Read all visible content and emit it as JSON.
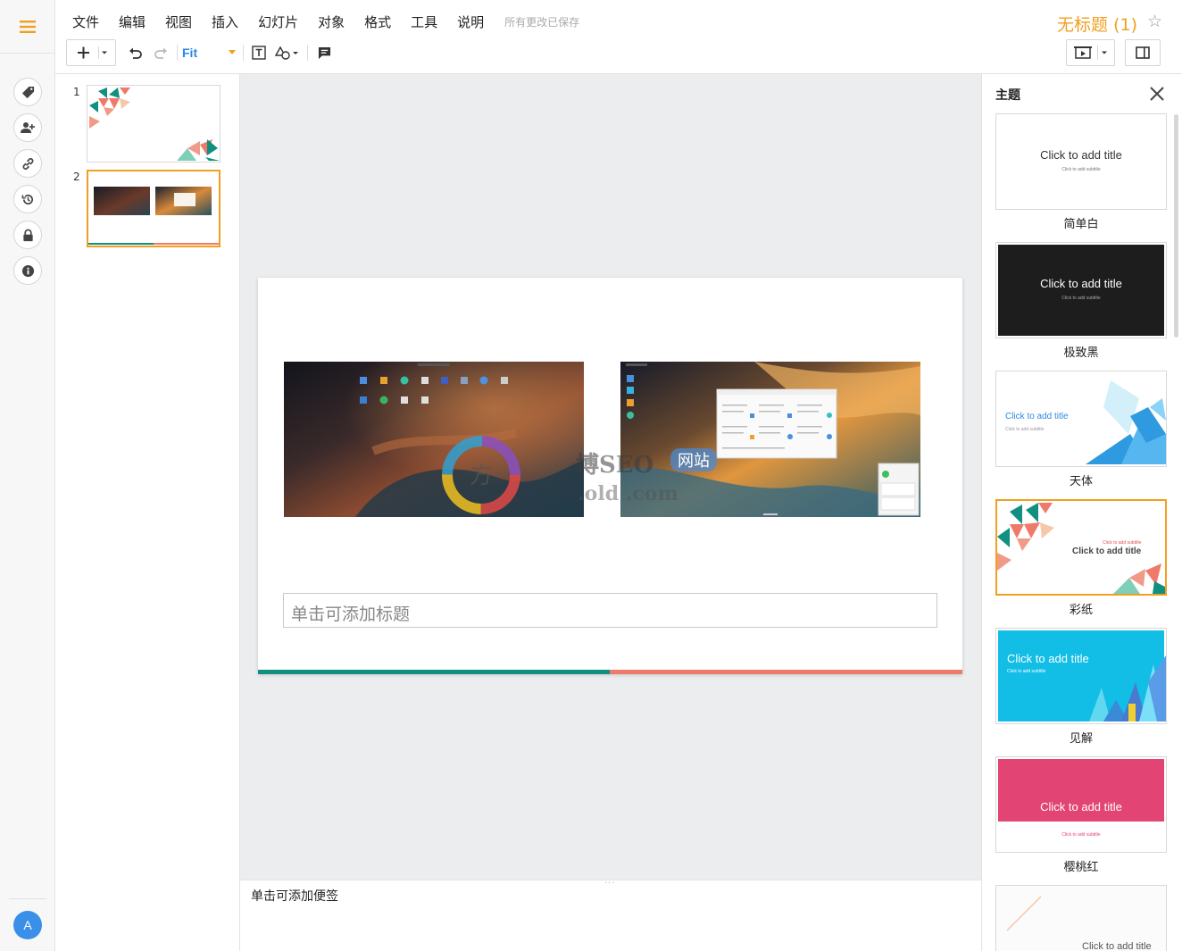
{
  "menu": {
    "items": [
      "文件",
      "编辑",
      "视图",
      "插入",
      "幻灯片",
      "对象",
      "格式",
      "工具",
      "说明"
    ],
    "save_status": "所有更改已保存"
  },
  "document": {
    "title": "无标题 (1)"
  },
  "toolbar": {
    "zoom_value": "Fit"
  },
  "user": {
    "avatar_initial": "A"
  },
  "slides": [
    {
      "number": "1"
    },
    {
      "number": "2"
    }
  ],
  "slide_editor": {
    "title_placeholder": "单击可添加标题"
  },
  "notes": {
    "placeholder": "单击可添加便签"
  },
  "theme_panel": {
    "heading": "主题",
    "themes": [
      {
        "name": "简单白",
        "sample_title": "Click to add title",
        "sample_subtitle": "Click to add subtitle"
      },
      {
        "name": "极致黑",
        "sample_title": "Click to add title",
        "sample_subtitle": "Click to add subtitle"
      },
      {
        "name": "天体",
        "sample_title": "Click to add title",
        "sample_subtitle": "Click to add subtitle"
      },
      {
        "name": "彩纸",
        "sample_title": "Click to add title",
        "sample_subtitle": "Click to add subtitle"
      },
      {
        "name": "见解",
        "sample_title": "Click to add title",
        "sample_subtitle": "Click to add subtitle"
      },
      {
        "name": "樱桃红",
        "sample_title": "Click to add title",
        "sample_subtitle": "Click to add subtitle"
      },
      {
        "name": "",
        "sample_title": "Click to add title",
        "sample_subtitle": ""
      }
    ]
  },
  "watermark": {
    "text": "博SEO",
    "badge": "网站",
    "sub": ".old            .com"
  },
  "colors": {
    "accent": "#f0a020",
    "teal": "#0f9080",
    "coral": "#ef7a6a",
    "blue": "#2a8ae6"
  },
  "icons": [
    "hamburger-menu-icon",
    "tag-icon",
    "add-user-icon",
    "link-icon",
    "history-icon",
    "lock-icon",
    "info-icon",
    "plus-icon",
    "undo-icon",
    "redo-icon",
    "text-box-icon",
    "shape-icon",
    "comment-icon",
    "present-icon",
    "sidebar-toggle-icon",
    "star-icon",
    "close-icon"
  ]
}
